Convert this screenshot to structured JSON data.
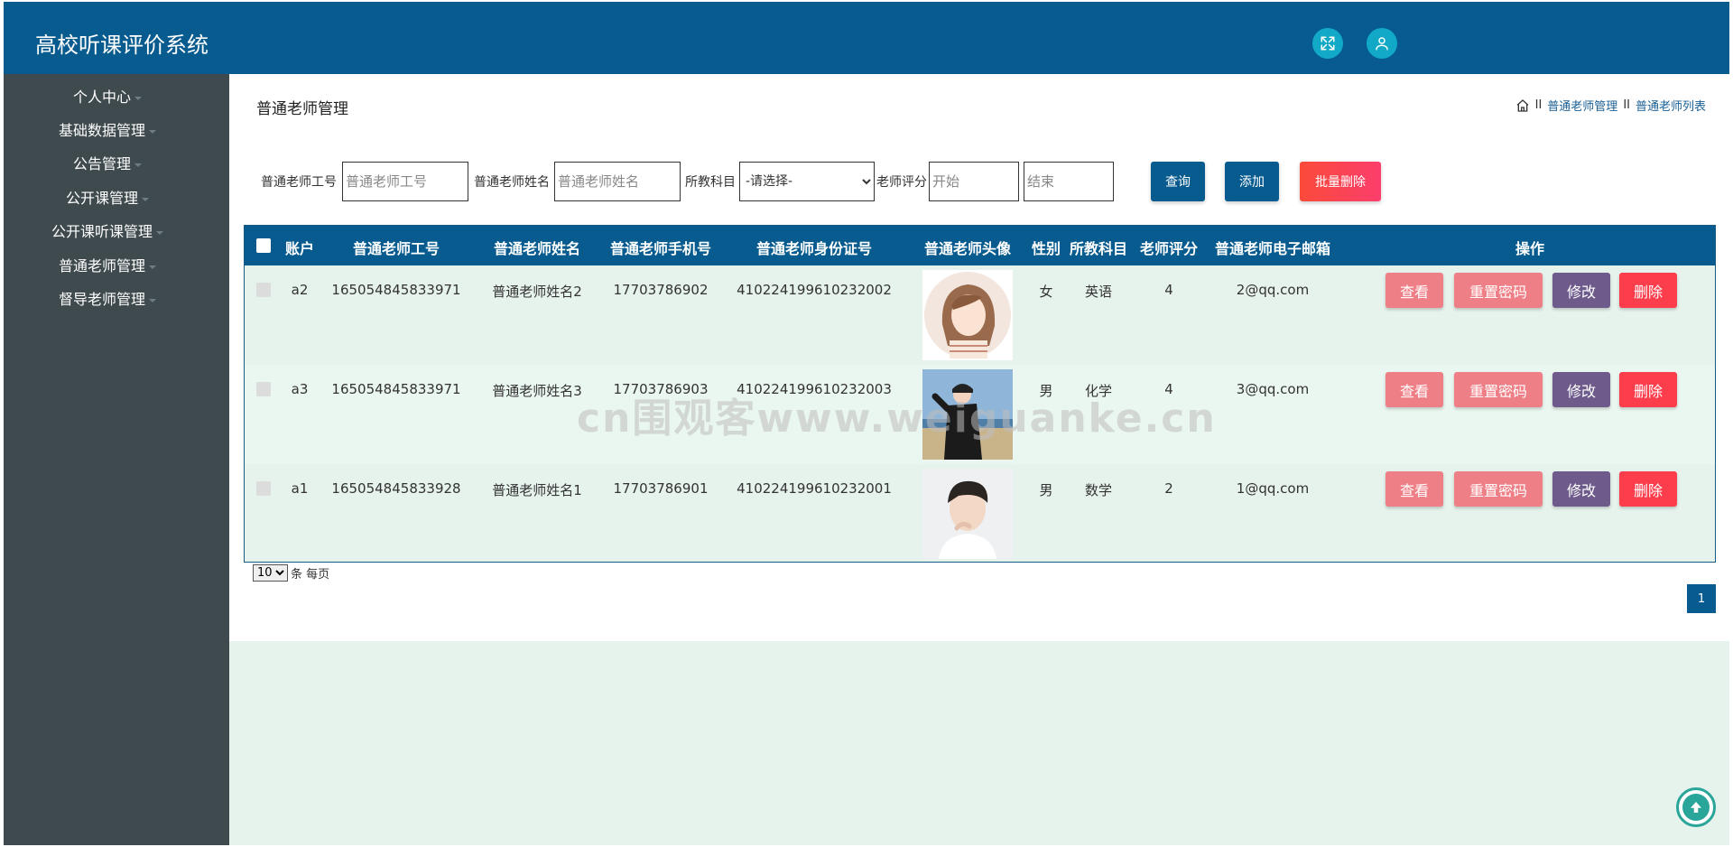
{
  "app_title": "高校听课评价系统",
  "header_icons": [
    "fullscreen-icon",
    "user-icon"
  ],
  "sidebar": {
    "items": [
      {
        "label": "个人中心"
      },
      {
        "label": "基础数据管理"
      },
      {
        "label": "公告管理"
      },
      {
        "label": "公开课管理"
      },
      {
        "label": "公开课听课管理"
      },
      {
        "label": "普通老师管理"
      },
      {
        "label": "督导老师管理"
      }
    ]
  },
  "page": {
    "title": "普通老师管理",
    "breadcrumb": [
      "普通老师管理",
      "普通老师列表"
    ],
    "breadcrumb_sep": "II"
  },
  "filters": {
    "id_label": "普通老师工号",
    "id_placeholder": "普通老师工号",
    "name_label": "普通老师姓名",
    "name_placeholder": "普通老师姓名",
    "subject_label": "所教科目",
    "subject_selected": "-请选择-",
    "score_label": "老师评分",
    "score_start_placeholder": "开始",
    "score_end_placeholder": "结束",
    "query_label": "查询",
    "add_label": "添加",
    "batch_delete_label": "批量删除"
  },
  "table": {
    "headers": [
      "账户",
      "普通老师工号",
      "普通老师姓名",
      "普通老师手机号",
      "普通老师身份证号",
      "普通老师头像",
      "性别",
      "所教科目",
      "老师评分",
      "普通老师电子邮箱",
      "操作"
    ],
    "rows": [
      {
        "account": "a2",
        "job_no": "165054845833971",
        "name": "普通老师姓名2",
        "phone": "17703786902",
        "id_card": "410224199610232002",
        "gender": "女",
        "subject": "英语",
        "score": "4",
        "email": "2@qq.com"
      },
      {
        "account": "a3",
        "job_no": "165054845833971",
        "name": "普通老师姓名3",
        "phone": "17703786903",
        "id_card": "410224199610232003",
        "gender": "男",
        "subject": "化学",
        "score": "4",
        "email": "3@qq.com"
      },
      {
        "account": "a1",
        "job_no": "165054845833928",
        "name": "普通老师姓名1",
        "phone": "17703786901",
        "id_card": "410224199610232001",
        "gender": "男",
        "subject": "数学",
        "score": "2",
        "email": "1@qq.com"
      }
    ],
    "actions": {
      "view": "查看",
      "reset_password": "重置密码",
      "edit": "修改",
      "delete": "删除"
    }
  },
  "pagination": {
    "page_size": "10",
    "page_size_suffix": "条 每页",
    "current_page": "1"
  },
  "watermark": "cn围观客www.weiguanke.cn",
  "colors": {
    "primary": "#075b8f",
    "sidebar": "#3f4a4e",
    "background": "#e6f2ec",
    "view": "#ef7f86",
    "edit": "#6e5b8c",
    "delete": "#fc3d4c",
    "batch_delete": "#fb4545"
  }
}
